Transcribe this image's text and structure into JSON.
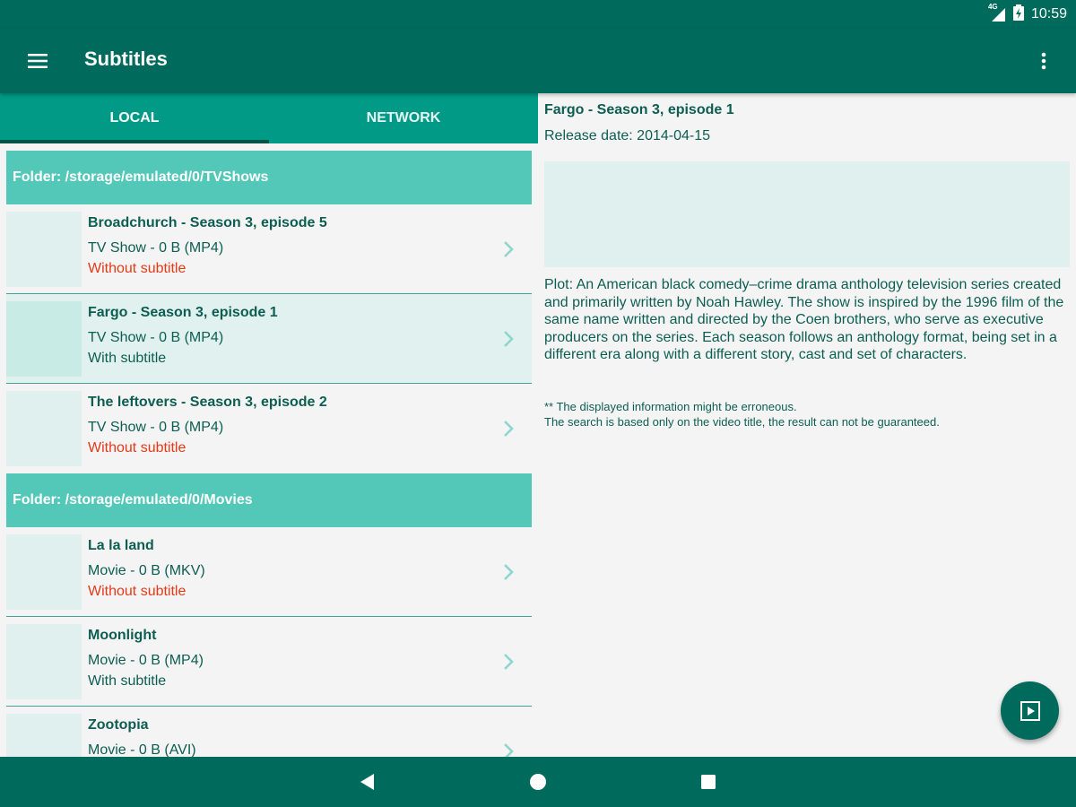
{
  "status_bar": {
    "network_label": "4G",
    "time": "10:59"
  },
  "app_bar": {
    "title": "Subtitles"
  },
  "tabs": [
    {
      "label": "LOCAL",
      "selected": true
    },
    {
      "label": "NETWORK",
      "selected": false
    }
  ],
  "folders": [
    {
      "label": "Folder: /storage/emulated/0/TVShows",
      "items": [
        {
          "title": "Broadchurch - Season 3, episode 5",
          "meta": "TV Show - 0 B (MP4)",
          "subtitle": "Without subtitle"
        },
        {
          "title": "Fargo - Season 3, episode 1",
          "meta": "TV Show - 0 B (MP4)",
          "subtitle": "With subtitle"
        },
        {
          "title": "The leftovers - Season 3, episode 2",
          "meta": "TV Show - 0 B (MP4)",
          "subtitle": "Without subtitle"
        }
      ]
    },
    {
      "label": "Folder: /storage/emulated/0/Movies",
      "items": [
        {
          "title": "La la land",
          "meta": "Movie - 0 B (MKV)",
          "subtitle": "Without subtitle"
        },
        {
          "title": "Moonlight",
          "meta": "Movie - 0 B (MP4)",
          "subtitle": "With subtitle"
        },
        {
          "title": "Zootopia",
          "meta": "Movie - 0 B (AVI)",
          "subtitle": ""
        }
      ]
    }
  ],
  "detail": {
    "title": "Fargo - Season 3, episode 1",
    "release": "Release date: 2014-04-15",
    "plot": "Plot: An American black comedy–crime drama anthology television series created and primarily written by Noah Hawley. The show is inspired by the 1996 film of the same name written and directed by the Coen brothers, who serve as executive producers on the series. Each season follows an anthology format, being set in a different era along with a different story, cast and set of characters.",
    "disclaimer_line1": "** The displayed information might be erroneous.",
    "disclaimer_line2": "The search is based only on the video title, the result can not be guaranteed."
  },
  "icons": {
    "menu": "menu-icon",
    "more": "more-vert-icon",
    "chevron": "chevron-right-icon",
    "fab": "play-icon",
    "nav_back": "back-icon",
    "nav_home": "home-icon",
    "nav_recents": "recents-icon"
  },
  "colors": {
    "primary_dark": "#006b5c",
    "tab_bar": "#009a87",
    "folder_header": "#53c8b8",
    "without_subtitle": "#e53a17",
    "text": "#0d5e52"
  }
}
